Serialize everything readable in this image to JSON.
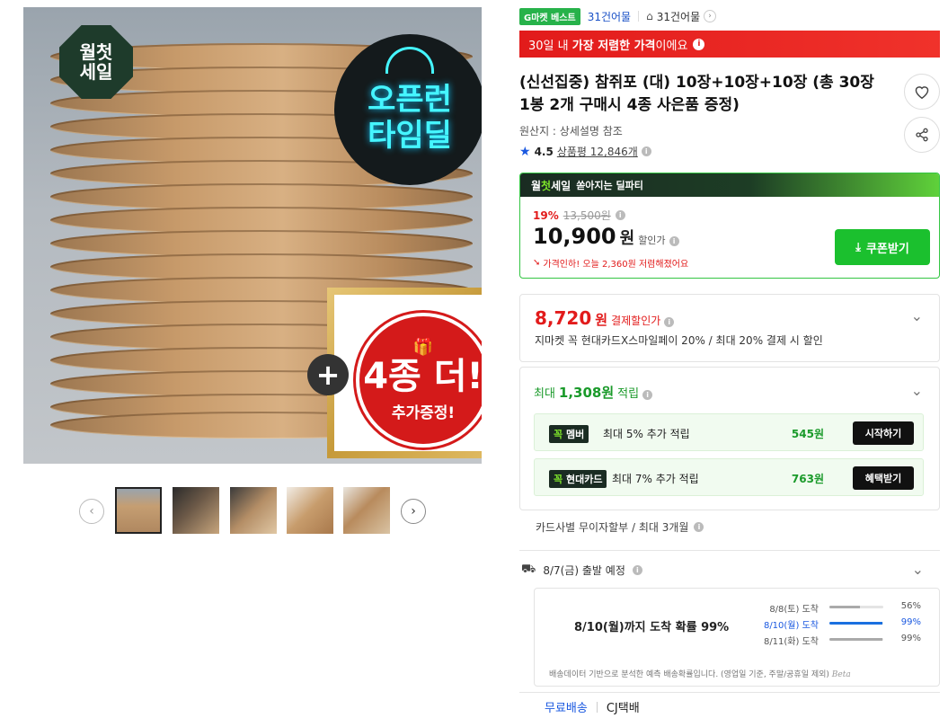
{
  "gallery": {
    "badge_top": "월첫",
    "badge_bottom": "세일",
    "timedeal_line1": "오픈런",
    "timedeal_line2": "타임딜",
    "gift_big": "4종 더!",
    "gift_small": "추가증정!",
    "plus": "+",
    "prev_arrow": "‹",
    "next_arrow": "›"
  },
  "seller": {
    "best_badge": "G마켓 베스트",
    "name": "31건어물",
    "store_name": "31건어물"
  },
  "lowest_banner": {
    "prefix": "30일 내",
    "highlight": "가장 저렴한 가격",
    "suffix": "이에요"
  },
  "product": {
    "title": "(신선집중) 참쥐포 (대) 10장+10장+10장 (총 30장 1봉 2개 구매시 4종 사은품 증정)",
    "origin": "원산지 : 상세설명 참조",
    "rating": "4.5",
    "review_link": "상품평 12,846개"
  },
  "deal": {
    "brand_a": "월",
    "brand_b": "첫",
    "brand_c": "세일",
    "tagline": "쏟아지는 딜파티",
    "discount_rate": "19%",
    "original_price": "13,500원",
    "price": "10,900",
    "price_unit": "원",
    "price_label": "할인가",
    "note": "가격인하! 오늘 2,360원 저렴해졌어요",
    "coupon_button": "쿠폰받기"
  },
  "payment": {
    "price": "8,720",
    "unit": "원",
    "label": "결제할인가",
    "desc": "지마켓 꼭 현대카드X스마일페이 20% / 최대 20% 결제 시 할인"
  },
  "points": {
    "prefix": "최대",
    "amount": "1,308원",
    "suffix": "적립",
    "rows": [
      {
        "tag_a": "꼭",
        "tag_b": "멤버",
        "text": "최대 5% 추가 적립",
        "amount": "545원",
        "button": "시작하기"
      },
      {
        "tag_a": "꼭",
        "tag_b": "현대카드",
        "text": "최대 7% 추가 적립",
        "amount": "763원",
        "button": "혜택받기"
      }
    ]
  },
  "installment": "카드사별 무이자할부 / 최대 3개월",
  "shipping": {
    "depart": "8/7(금) 출발 예정",
    "headline": "8/10(월)까지 도착 확률 99%",
    "lines": [
      {
        "date": "8/8(토) 도착",
        "pct": "56%",
        "value": 0.56
      },
      {
        "date": "8/10(월) 도착",
        "pct": "99%",
        "value": 0.99
      },
      {
        "date": "8/11(화) 도착",
        "pct": "99%",
        "value": 0.99
      }
    ],
    "footnote": "배송데이터 기반으로 분석한 예측 배송확률입니다. (영업일 기준, 주말/공휴일 제외)",
    "beta": "Beta",
    "free": "무료배송",
    "courier": "CJ택배"
  },
  "colors": {
    "accent_green": "#1bc02e",
    "accent_red": "#e21b1b",
    "link_blue": "#1a58e0"
  },
  "icons": [
    "heart-icon",
    "share-icon",
    "star-icon",
    "info-icon",
    "chevron-down-icon",
    "download-icon",
    "truck-icon",
    "home-icon"
  ]
}
